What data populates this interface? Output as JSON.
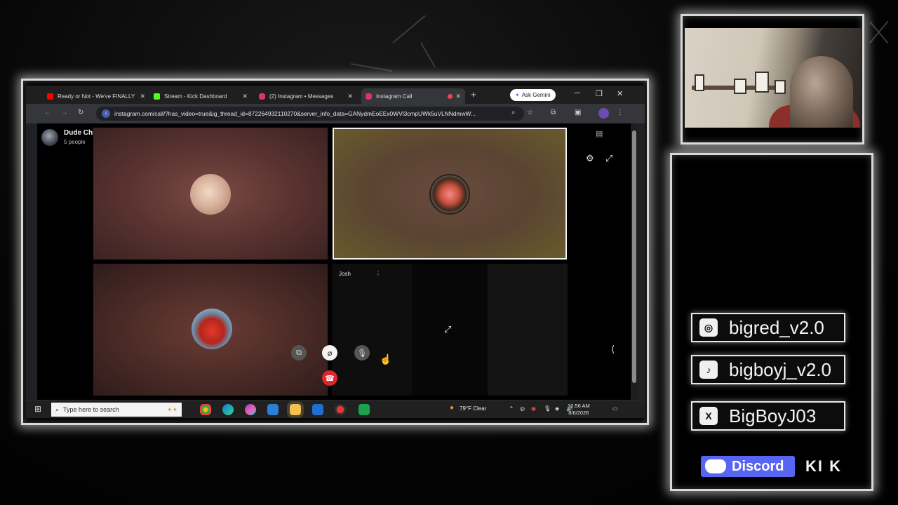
{
  "browser": {
    "tabs": [
      {
        "label": "Ready or Not - We've FINALLY",
        "favicon_color": "#ff0000"
      },
      {
        "label": "Stream - Kick Dashboard",
        "favicon_color": "#53fc18"
      },
      {
        "label": "(2) Instagram • Messages",
        "favicon_color": "#e1306c"
      },
      {
        "label": "Instagram Call",
        "favicon_color": "#e1306c",
        "active": true
      }
    ],
    "new_tab_icon": "+",
    "gemini_label": "Ask Gemini",
    "url": "instagram.com/call/?has_video=true&ig_thread_id=872264932110270&server_info_data=GANydmEoEEx0WVl3cmpUWk5uVLNNdmwW..."
  },
  "call": {
    "group_name": "Dude Chill Just Chill",
    "member_count": "5 people",
    "participant_label": "Josh"
  },
  "taskbar": {
    "search_placeholder": "Type here to search",
    "weather": "79°F Clear",
    "time": "12:56 AM",
    "date": "8/6/2026"
  },
  "socials": {
    "instagram": "bigred_v2.0",
    "tiktok": "bigboyj_v2.0",
    "x": "BigBoyJ03",
    "discord": "Discord",
    "kick": "KI K"
  },
  "colors": {
    "accent": "#5865f2",
    "end_call": "#e0252b",
    "glow": "#ffffff"
  }
}
